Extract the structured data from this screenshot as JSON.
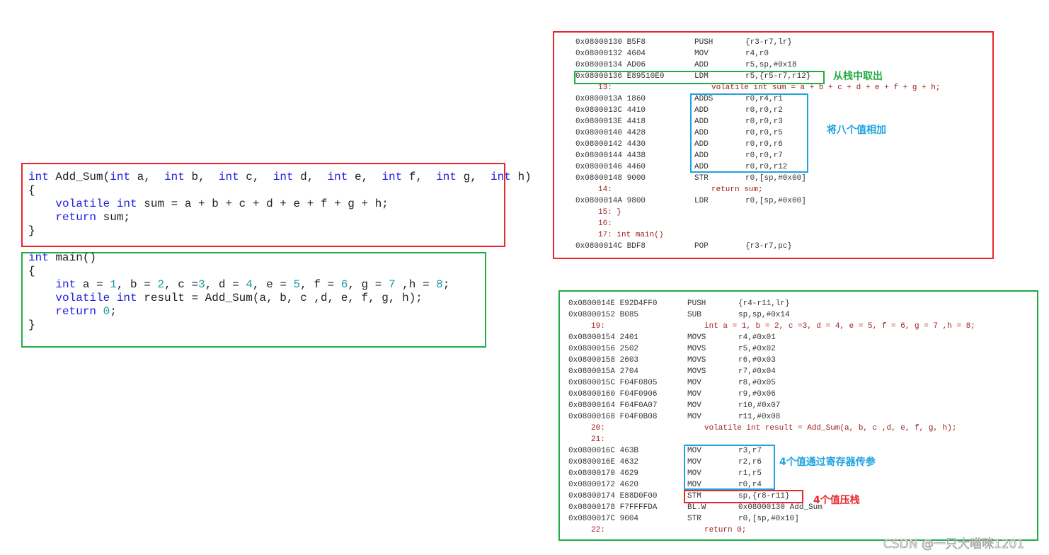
{
  "colors": {
    "red": "#e8262c",
    "green": "#21ac45",
    "blue": "#1ea3e0",
    "keyword": "#2020e0",
    "number": "#1d9c9c",
    "source": "#a02020"
  },
  "c_code": {
    "add_sum": [
      [
        [
          "int",
          "kw"
        ],
        [
          " Add_Sum(",
          ""
        ],
        [
          "int",
          "kw"
        ],
        [
          " a,  ",
          ""
        ],
        [
          "int",
          "kw"
        ],
        [
          " b,  ",
          ""
        ],
        [
          "int",
          "kw"
        ],
        [
          " c,  ",
          ""
        ],
        [
          "int",
          "kw"
        ],
        [
          " d,  ",
          ""
        ],
        [
          "int",
          "kw"
        ],
        [
          " e,  ",
          ""
        ],
        [
          "int",
          "kw"
        ],
        [
          " f,  ",
          ""
        ],
        [
          "int",
          "kw"
        ],
        [
          " g,  ",
          ""
        ],
        [
          "int",
          "kw"
        ],
        [
          " h)",
          ""
        ]
      ],
      [
        [
          "{",
          ""
        ]
      ],
      [
        [
          "    ",
          ""
        ],
        [
          "volatile",
          "kw"
        ],
        [
          " ",
          ""
        ],
        [
          "int",
          "kw"
        ],
        [
          " sum = a + b + c + d + e + f + g + h;",
          ""
        ]
      ],
      [
        [
          "    ",
          ""
        ],
        [
          "return",
          "kw"
        ],
        [
          " sum;",
          ""
        ]
      ],
      [
        [
          "}",
          ""
        ]
      ]
    ],
    "main": [
      [
        [
          "int",
          "kw"
        ],
        [
          " main()",
          ""
        ]
      ],
      [
        [
          "{",
          ""
        ]
      ],
      [
        [
          "    ",
          ""
        ],
        [
          "int",
          "kw"
        ],
        [
          " a = ",
          ""
        ],
        [
          "1",
          "num"
        ],
        [
          ", b = ",
          ""
        ],
        [
          "2",
          "num"
        ],
        [
          ", c =",
          ""
        ],
        [
          "3",
          "num"
        ],
        [
          ", d = ",
          ""
        ],
        [
          "4",
          "num"
        ],
        [
          ", e = ",
          ""
        ],
        [
          "5",
          "num"
        ],
        [
          ", f = ",
          ""
        ],
        [
          "6",
          "num"
        ],
        [
          ", g = ",
          ""
        ],
        [
          "7",
          "num"
        ],
        [
          " ,h = ",
          ""
        ],
        [
          "8",
          "num"
        ],
        [
          ";",
          ""
        ]
      ],
      [
        [
          "    ",
          ""
        ],
        [
          "volatile",
          "kw"
        ],
        [
          " ",
          ""
        ],
        [
          "int",
          "kw"
        ],
        [
          " result = Add_Sum(a, b, c ,d, e, f, g, h);",
          ""
        ]
      ],
      [
        [
          "",
          ""
        ]
      ],
      [
        [
          "    ",
          ""
        ],
        [
          "return",
          "kw"
        ],
        [
          " ",
          ""
        ],
        [
          "0",
          "num"
        ],
        [
          ";",
          ""
        ]
      ],
      [
        [
          "}",
          ""
        ]
      ]
    ]
  },
  "disasm_add_sum": [
    {
      "addr": "0x08000130 B5F8",
      "mn": "PUSH",
      "op": "{r3-r7,lr}"
    },
    {
      "addr": "0x08000132 4604",
      "mn": "MOV",
      "op": "r4,r0"
    },
    {
      "addr": "0x08000134 AD06",
      "mn": "ADD",
      "op": "r5,sp,#0x18"
    },
    {
      "addr": "0x08000136 E89510E0",
      "mn": "LDM",
      "op": "r5,{r5-r7,r12}"
    },
    {
      "ln": "13:",
      "src": "volatile int sum = a + b + c + d + e + f + g + h;"
    },
    {
      "addr": "0x0800013A 1860",
      "mn": "ADDS",
      "op": "r0,r4,r1"
    },
    {
      "addr": "0x0800013C 4410",
      "mn": "ADD",
      "op": "r0,r0,r2"
    },
    {
      "addr": "0x0800013E 4418",
      "mn": "ADD",
      "op": "r0,r0,r3"
    },
    {
      "addr": "0x08000140 4428",
      "mn": "ADD",
      "op": "r0,r0,r5"
    },
    {
      "addr": "0x08000142 4430",
      "mn": "ADD",
      "op": "r0,r0,r6"
    },
    {
      "addr": "0x08000144 4438",
      "mn": "ADD",
      "op": "r0,r0,r7"
    },
    {
      "addr": "0x08000146 4460",
      "mn": "ADD",
      "op": "r0,r0,r12"
    },
    {
      "addr": "0x08000148 9000",
      "mn": "STR",
      "op": "r0,[sp,#0x00]"
    },
    {
      "ln": "14:",
      "src": "return sum;"
    },
    {
      "addr": "0x0800014A 9800",
      "mn": "LDR",
      "op": "r0,[sp,#0x00]"
    },
    {
      "ln": "15: }",
      "src": ""
    },
    {
      "ln": "16:",
      "src": ""
    },
    {
      "ln": "17: int main()",
      "src": ""
    },
    {
      "addr": "0x0800014C BDF8",
      "mn": "POP",
      "op": "{r3-r7,pc}"
    }
  ],
  "disasm_main": [
    {
      "addr": "0x0800014E E92D4FF0",
      "mn": "PUSH",
      "op": "{r4-r11,lr}"
    },
    {
      "addr": "0x08000152 B085",
      "mn": "SUB",
      "op": "sp,sp,#0x14"
    },
    {
      "ln": "19:",
      "src": "int a = 1, b = 2, c =3, d = 4, e = 5, f = 6, g = 7 ,h = 8;"
    },
    {
      "addr": "0x08000154 2401",
      "mn": "MOVS",
      "op": "r4,#0x01"
    },
    {
      "addr": "0x08000156 2502",
      "mn": "MOVS",
      "op": "r5,#0x02"
    },
    {
      "addr": "0x08000158 2603",
      "mn": "MOVS",
      "op": "r6,#0x03"
    },
    {
      "addr": "0x0800015A 2704",
      "mn": "MOVS",
      "op": "r7,#0x04"
    },
    {
      "addr": "0x0800015C F04F0805",
      "mn": "MOV",
      "op": "r8,#0x05"
    },
    {
      "addr": "0x08000160 F04F0906",
      "mn": "MOV",
      "op": "r9,#0x06"
    },
    {
      "addr": "0x08000164 F04F0A07",
      "mn": "MOV",
      "op": "r10,#0x07"
    },
    {
      "addr": "0x08000168 F04F0B08",
      "mn": "MOV",
      "op": "r11,#0x08"
    },
    {
      "ln": "20:",
      "src": "volatile int result = Add_Sum(a, b, c ,d, e, f, g, h);"
    },
    {
      "ln": "21:",
      "src": ""
    },
    {
      "addr": "0x0800016C 463B",
      "mn": "MOV",
      "op": "r3,r7"
    },
    {
      "addr": "0x0800016E 4632",
      "mn": "MOV",
      "op": "r2,r6"
    },
    {
      "addr": "0x08000170 4629",
      "mn": "MOV",
      "op": "r1,r5"
    },
    {
      "addr": "0x08000172 4620",
      "mn": "MOV",
      "op": "r0,r4"
    },
    {
      "addr": "0x08000174 E88D0F00",
      "mn": "STM",
      "op": "sp,{r8-r11}"
    },
    {
      "addr": "0x08000178 F7FFFFDA",
      "mn": "BL.W",
      "op": "0x08000130 Add_Sum"
    },
    {
      "addr": "0x0800017C 9004",
      "mn": "STR",
      "op": "r0,[sp,#0x10]"
    },
    {
      "ln": "22:",
      "src": "return 0;"
    }
  ],
  "annotations": {
    "pop_from_stack": "从栈中取出",
    "add_eight_values": "将八个值相加",
    "four_values_by_registers": "4个值通过寄存器传参",
    "four_values_pushed": "4个值压栈"
  },
  "watermark": "CSDN @一只大喵咪1201"
}
